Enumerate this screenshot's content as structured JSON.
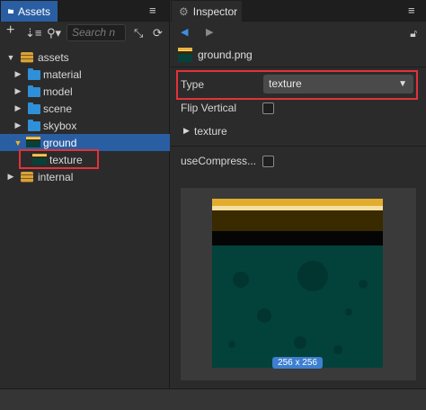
{
  "assets_panel": {
    "tab_label": "Assets",
    "search": {
      "placeholder": "Search n"
    },
    "tree": [
      {
        "label": "assets",
        "icon": "database-icon",
        "expanded": true
      },
      {
        "label": "material",
        "icon": "folder-icon"
      },
      {
        "label": "model",
        "icon": "folder-icon"
      },
      {
        "label": "scene",
        "icon": "folder-icon"
      },
      {
        "label": "skybox",
        "icon": "folder-icon"
      },
      {
        "label": "ground",
        "icon": "texture-icon",
        "expanded": true,
        "selected": true
      },
      {
        "label": "texture",
        "icon": "texture-icon"
      },
      {
        "label": "internal",
        "icon": "database-icon"
      }
    ]
  },
  "inspector_panel": {
    "tab_label": "Inspector",
    "file_name": "ground.png",
    "properties": {
      "type_label": "Type",
      "type_value": "texture",
      "flip_vertical_label": "Flip Vertical",
      "flip_vertical_checked": false,
      "texture_section_label": "texture",
      "use_compress_label": "useCompress...",
      "use_compress_checked": false
    },
    "preview": {
      "size_label": "256 x 256"
    }
  },
  "colors": {
    "accent": "#2a5ea3",
    "highlight_box": "#e2323c",
    "folder": "#2f8fd8",
    "badge": "#3d7fd0"
  }
}
